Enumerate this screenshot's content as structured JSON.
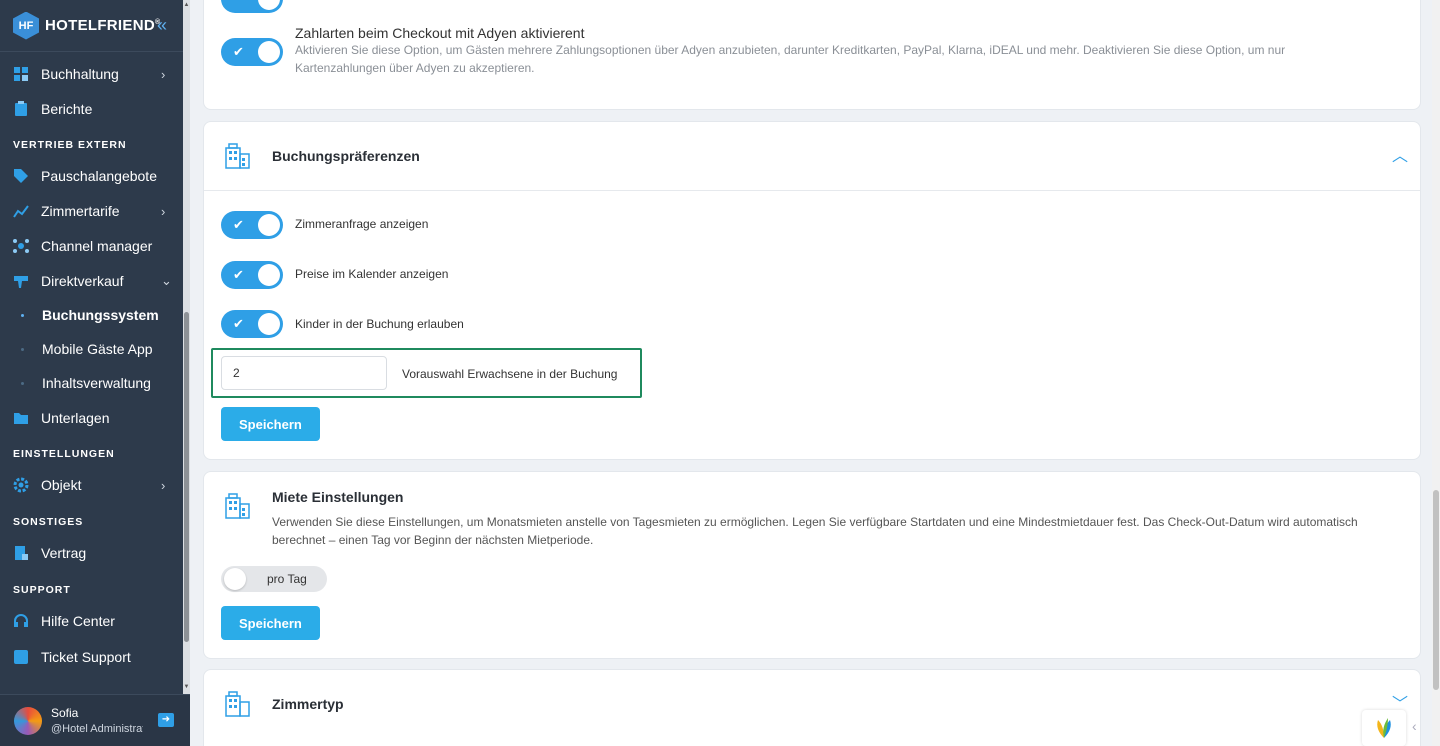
{
  "brand": {
    "name": "HOTELFRIEND",
    "mark": "HF",
    "trademark": "®"
  },
  "colors": {
    "sidebar": "#2d3a4b",
    "accent": "#2f9fe6",
    "button": "#2bace8",
    "highlight": "#1f8a5e"
  },
  "sidebar": {
    "items": [
      {
        "label": "Buchhaltung",
        "icon": "chart-grid-icon",
        "chevron": "›"
      },
      {
        "label": "Berichte",
        "icon": "clipboard-icon"
      }
    ],
    "section_vertrieb": "VERTRIEB EXTERN",
    "vertrieb_items": [
      {
        "label": "Pauschalangebote",
        "icon": "tag-icon"
      },
      {
        "label": "Zimmertarife",
        "icon": "line-chart-icon",
        "chevron": "›"
      },
      {
        "label": "Channel manager",
        "icon": "network-icon"
      },
      {
        "label": "Direktverkauf",
        "icon": "megaphone-icon",
        "chevron": "⌄"
      }
    ],
    "sub_items": [
      {
        "label": "Buchungssystem"
      },
      {
        "label": "Mobile Gäste App"
      },
      {
        "label": "Inhaltsverwaltung"
      }
    ],
    "unterlagen": "Unterlagen",
    "section_einstellungen": "EINSTELLUNGEN",
    "objekt": "Objekt",
    "section_sonstiges": "SONSTIGES",
    "vertrag": "Vertrag",
    "section_support": "SUPPORT",
    "hilfe": "Hilfe Center",
    "ticket": "Ticket Support",
    "user": {
      "name": "Sofia",
      "role": "@Hotel Administrator"
    }
  },
  "adyen": {
    "title": "Zahlarten beim Checkout mit Adyen aktivierent",
    "desc_line1": "Aktivieren Sie diese Option, um Gästen mehrere Zahlungsoptionen über Adyen anzubieten, darunter Kreditkarten, PayPal, Klarna, iDEAL und mehr. Deaktivieren Sie diese Option, um nur",
    "desc_line2": "Kartenzahlungen über Adyen zu akzeptieren.",
    "enabled": true
  },
  "booking_prefs": {
    "title": "Buchungspräferenzen",
    "toggles": [
      {
        "label": "Zimmeranfrage anzeigen",
        "enabled": true
      },
      {
        "label": "Preise im Kalender anzeigen",
        "enabled": true
      },
      {
        "label": "Kinder in der Buchung erlauben",
        "enabled": true
      }
    ],
    "adults_value": "2",
    "adults_label": "Vorauswahl Erwachsene in der Buchung",
    "save": "Speichern"
  },
  "rent": {
    "title": "Miete Einstellungen",
    "desc_line1": "Verwenden Sie diese Einstellungen, um Monatsmieten anstelle von Tagesmieten zu ermöglichen. Legen Sie verfügbare Startdaten und eine Mindestmietdauer fest. Das Check-Out-Datum wird automatisch",
    "desc_line2": "berechnet – einen Tag vor Beginn der nächsten Mietperiode.",
    "toggle_label": "pro Tag",
    "enabled": false,
    "save": "Speichern"
  },
  "room_type": {
    "title": "Zimmertyp"
  },
  "glyphs": {
    "check": "✔",
    "chevron_up": "︿",
    "chevron_down": "﹀",
    "collapse": "«",
    "scroll_up": "▲",
    "scroll_down": "▼",
    "back": "‹",
    "logout": "➜"
  }
}
